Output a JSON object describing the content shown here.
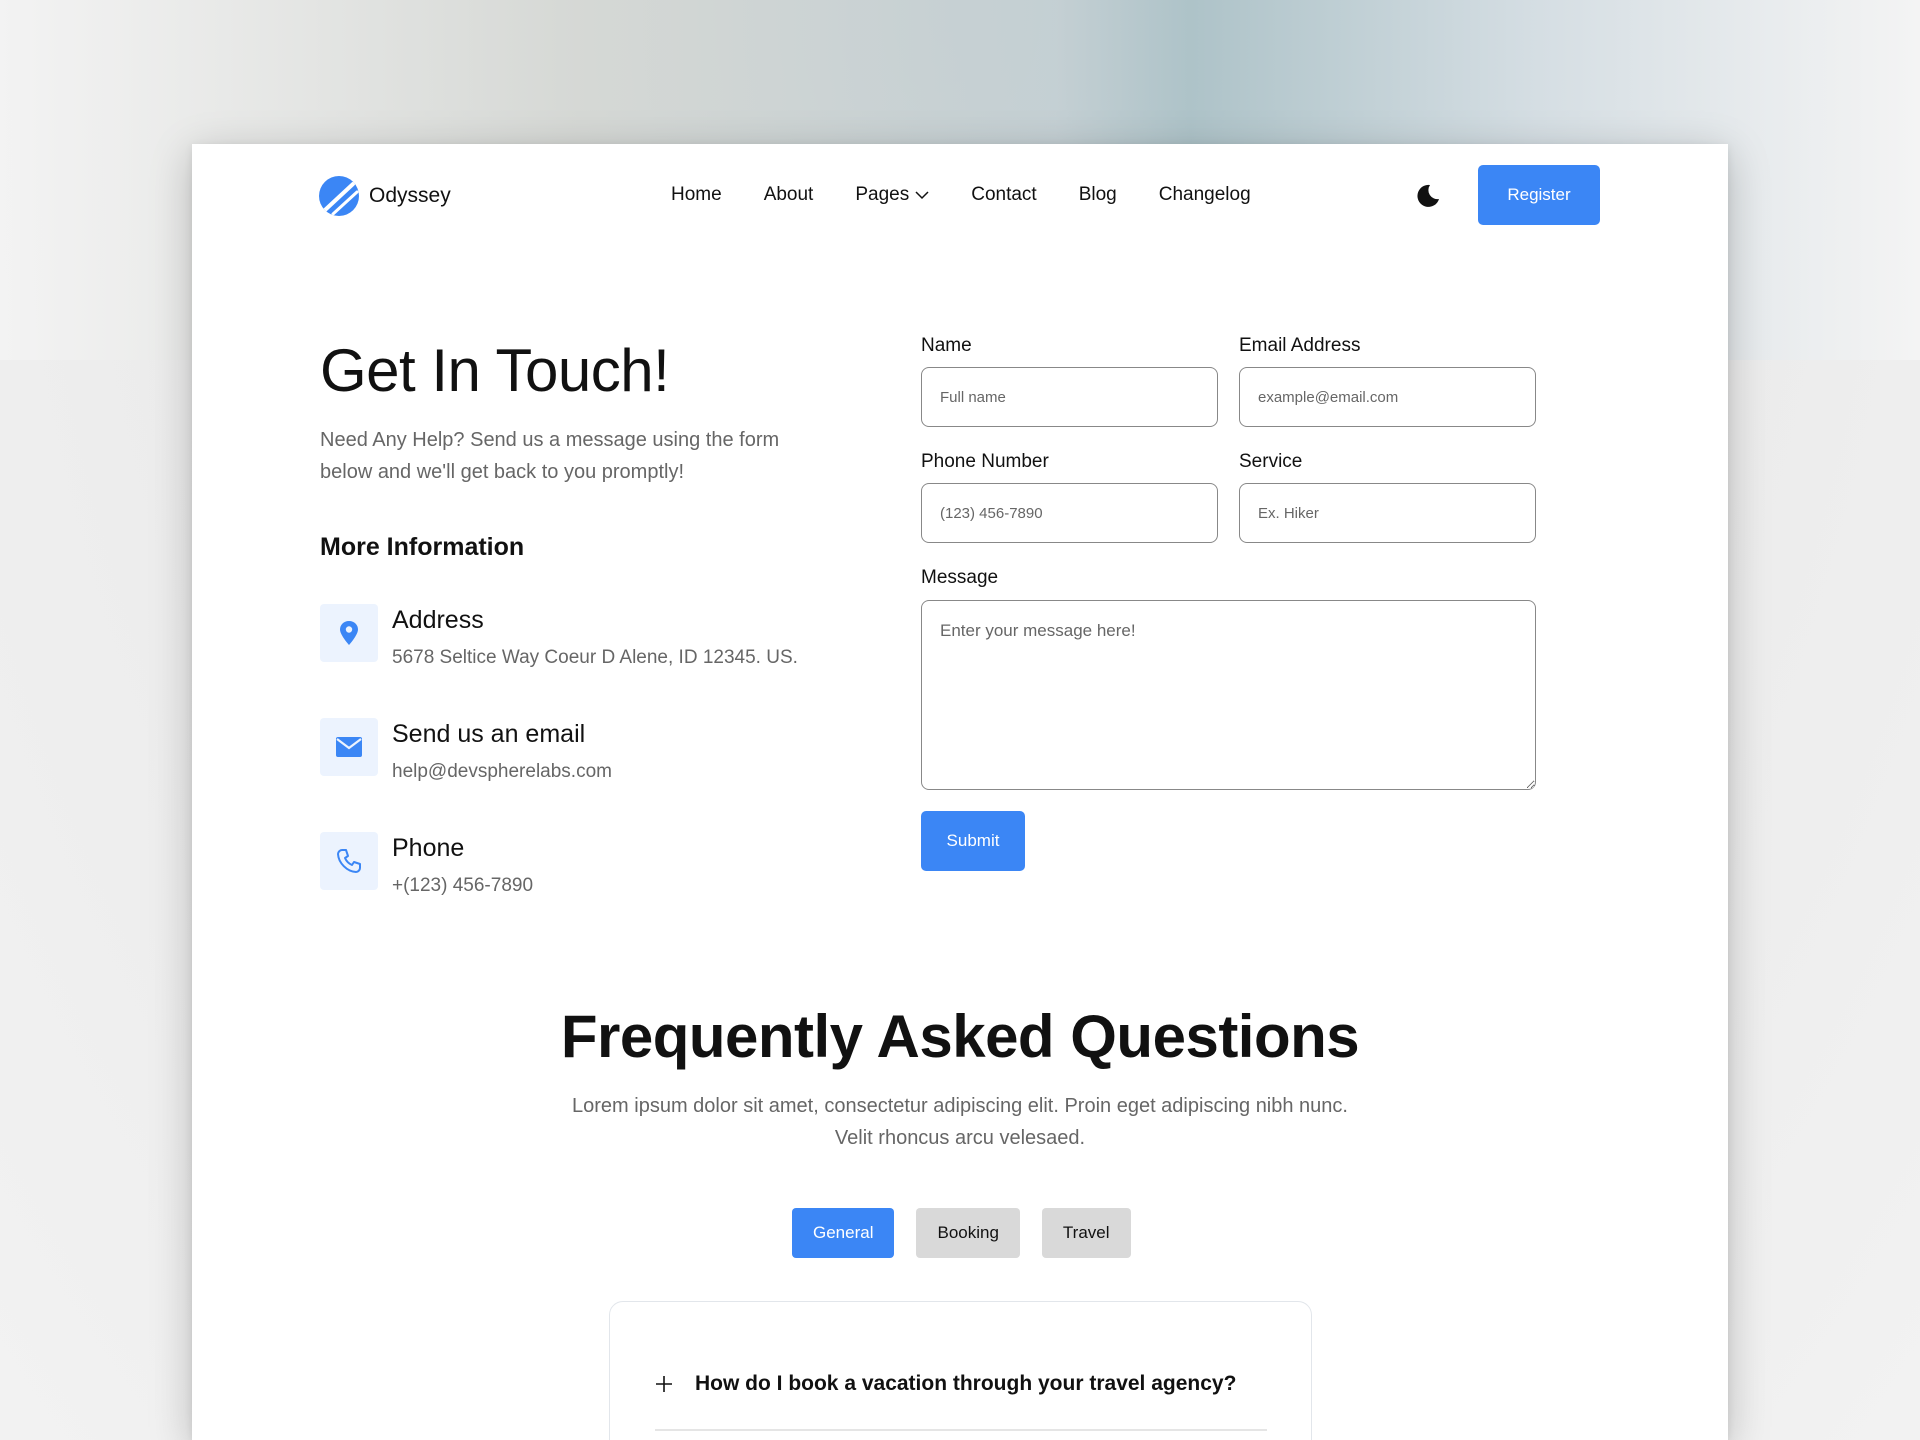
{
  "brand": {
    "name": "Odyssey",
    "accent": "#3b86f5"
  },
  "nav": {
    "links": [
      "Home",
      "About",
      "Pages",
      "Contact",
      "Blog",
      "Changelog"
    ],
    "register_label": "Register"
  },
  "hero": {
    "title": "Get In Touch!",
    "subtitle": "Need Any Help? Send us a message using the form below and we'll get back to you promptly!"
  },
  "more_info": {
    "heading": "More Information",
    "items": [
      {
        "icon": "location-pin-icon",
        "title": "Address",
        "value": "5678 Seltice Way Coeur D Alene, ID 12345. US."
      },
      {
        "icon": "mail-icon",
        "title": "Send us an email",
        "value": "help@devspherelabs.com"
      },
      {
        "icon": "phone-icon",
        "title": "Phone",
        "value": "+(123) 456-7890"
      }
    ]
  },
  "form": {
    "name": {
      "label": "Name",
      "placeholder": "Full name"
    },
    "email": {
      "label": "Email Address",
      "placeholder": "example@email.com"
    },
    "phone": {
      "label": "Phone Number",
      "placeholder": "(123) 456-7890"
    },
    "service": {
      "label": "Service",
      "placeholder": "Ex. Hiker"
    },
    "message": {
      "label": "Message",
      "placeholder": "Enter your message here!"
    },
    "submit_label": "Submit"
  },
  "faq": {
    "title": "Frequently Asked Questions",
    "subtitle": "Lorem ipsum dolor sit amet, consectetur adipiscing elit. Proin eget adipiscing nibh nunc. Velit rhoncus arcu velesaed.",
    "tabs": [
      "General",
      "Booking",
      "Travel"
    ],
    "active_tab": "General",
    "questions": [
      "How do I book a vacation through your travel agency?"
    ]
  }
}
